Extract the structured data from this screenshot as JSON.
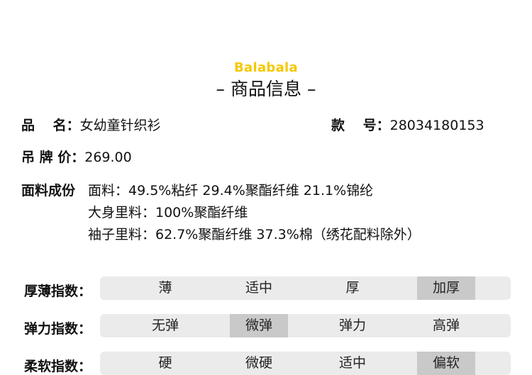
{
  "brand": {
    "logo_text": "Balabala"
  },
  "header": {
    "title": "– 商品信息 –"
  },
  "info": {
    "name_label": "品　 名：",
    "name_value": "女幼童针织衫",
    "sku_label": "款　 号：",
    "sku_value": "28034180153",
    "price_label": "吊 牌 价：",
    "price_value": "269.00",
    "composition_label": "面料成份",
    "composition_lines": [
      "面料：49.5%粘纤 29.4%聚酯纤维 21.1%锦纶",
      "大身里料：100%聚酯纤维",
      "袖子里料：62.7%聚酯纤维 37.3%棉（绣花配料除外）"
    ]
  },
  "scales": [
    {
      "label": "厚薄指数：",
      "options": [
        "薄",
        "适中",
        "厚",
        "加厚"
      ],
      "selected_index": 3
    },
    {
      "label": "弹力指数：",
      "options": [
        "无弹",
        "微弹",
        "弹力",
        "高弹"
      ],
      "selected_index": 1
    },
    {
      "label": "柔软指数：",
      "options": [
        "硬",
        "微硬",
        "适中",
        "偏软"
      ],
      "selected_index": 3
    }
  ],
  "colors": {
    "brand_yellow": "#f5c800",
    "bar_bg": "#ebebeb",
    "selected_bg": "#c9c9c9"
  }
}
